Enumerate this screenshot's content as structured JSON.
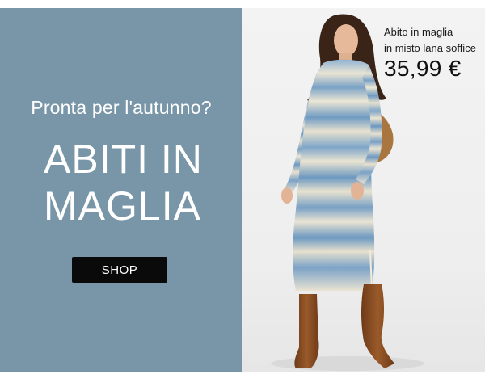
{
  "promo": {
    "subtitle": "Pronta per l'autunno?",
    "headline_line1": "ABITI IN",
    "headline_line2": "MAGLIA",
    "cta_label": "SHOP"
  },
  "product": {
    "name_line1": "Abito in maglia",
    "name_line2": "in misto lana soffice",
    "price": "35,99 €"
  },
  "colors": {
    "left_panel_bg": "#7896a8",
    "button_bg": "#0a0a0a",
    "dress_blue": "#7fa5c8",
    "dress_cream": "#ece6d4",
    "boots": "#8a4f22",
    "bag": "#a8763e",
    "hair": "#3a2418"
  },
  "icons": []
}
